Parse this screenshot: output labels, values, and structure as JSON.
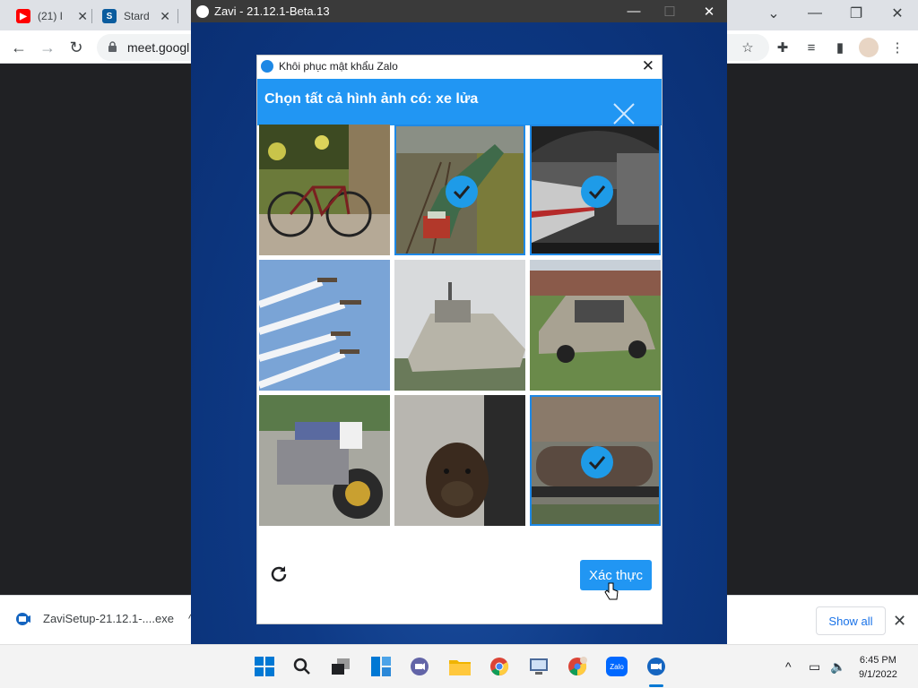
{
  "browser": {
    "tabs": [
      {
        "label": "(21) I",
        "icon": "youtube-icon"
      },
      {
        "label": "Stard",
        "icon": "stardock-icon"
      }
    ],
    "url": "meet.googl"
  },
  "downloads": {
    "filename": "ZaviSetup-21.12.1-....exe",
    "show_all_label": "Show all"
  },
  "zavi_window": {
    "title": "Zavi - 21.12.1-Beta.13"
  },
  "dialog": {
    "title": "Khôi phục mật khẩu Zalo",
    "instruction": "Chọn tất cả hình ảnh có: xe lửa",
    "verify_label": "Xác thực",
    "tiles": [
      {
        "subject": "bicycle",
        "selected": false
      },
      {
        "subject": "train",
        "selected": true
      },
      {
        "subject": "train-station",
        "selected": true
      },
      {
        "subject": "airplanes",
        "selected": false
      },
      {
        "subject": "ship",
        "selected": false
      },
      {
        "subject": "car",
        "selected": false
      },
      {
        "subject": "motorcycle",
        "selected": false
      },
      {
        "subject": "dog",
        "selected": false
      },
      {
        "subject": "tank-wagon",
        "selected": true
      }
    ]
  },
  "taskbar": {
    "time": "6:45 PM",
    "date": "9/1/2022",
    "apps": [
      "start-icon",
      "search-icon",
      "task-view-icon",
      "widgets-icon",
      "teams-chat-icon",
      "file-explorer-icon",
      "chrome-icon",
      "network-monitor-icon",
      "chrome-profile-icon",
      "zalo-icon",
      "zavi-icon"
    ]
  },
  "colors": {
    "accent": "#2196f3",
    "zavi_bg": "#0e3a86"
  }
}
